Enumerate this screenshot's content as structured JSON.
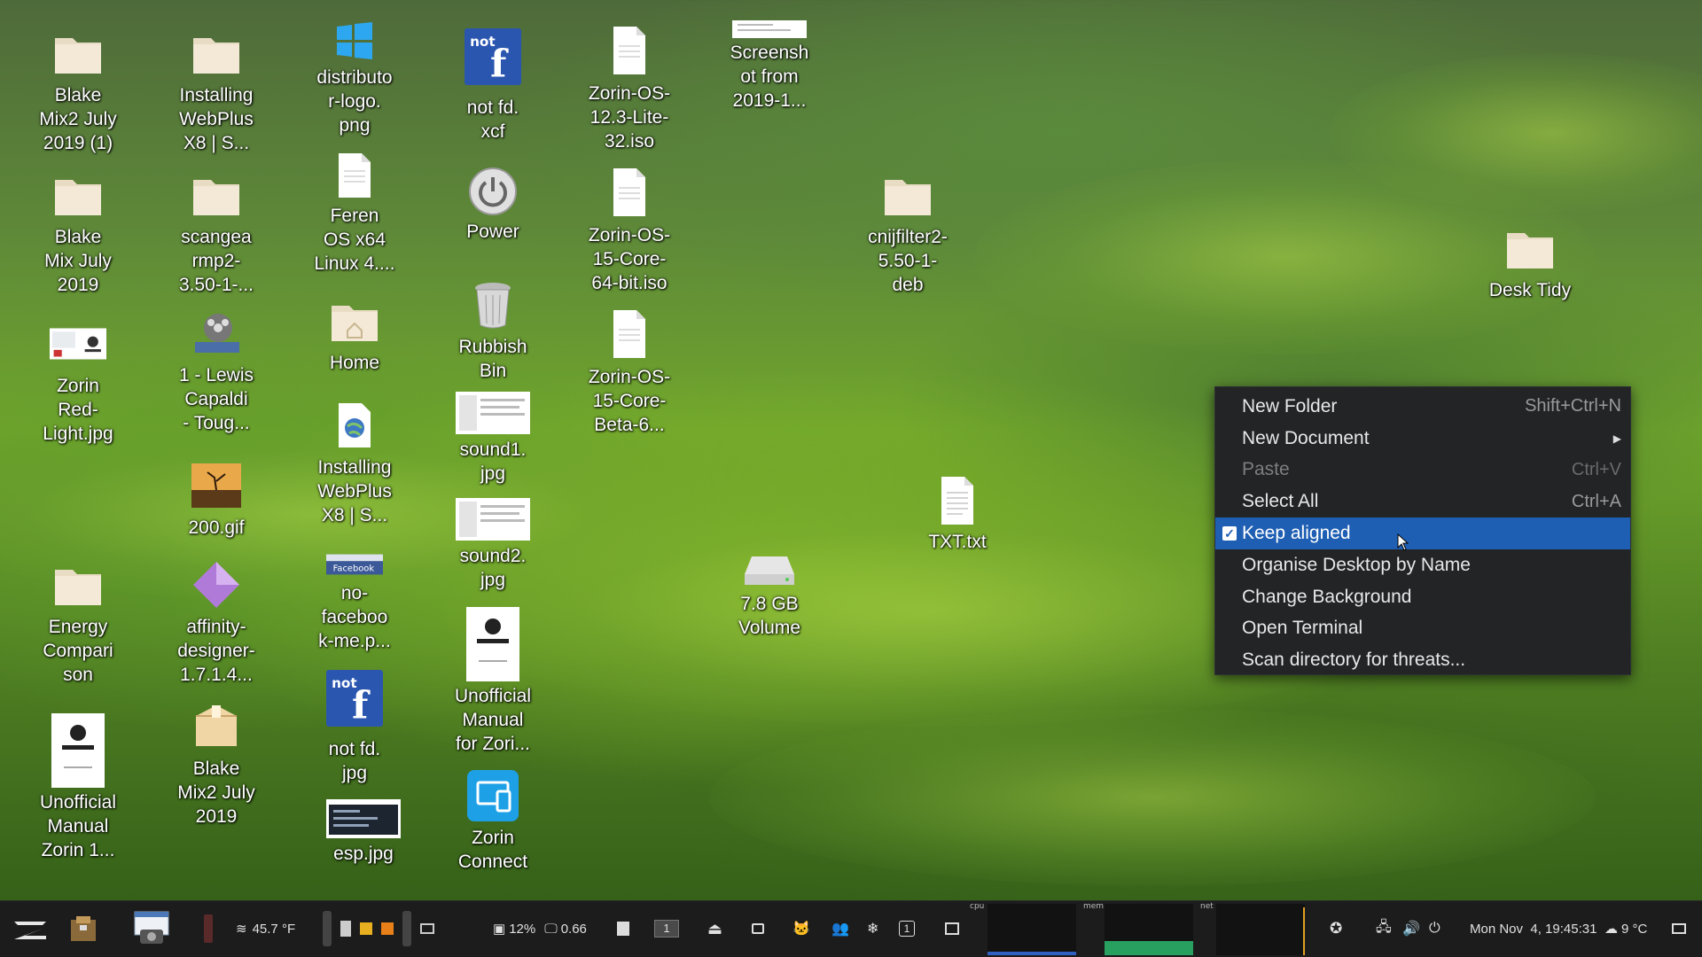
{
  "desktop_icons": [
    {
      "label": "Blake\nMix2 July\n2019 (1)",
      "icon": "folder-icon"
    },
    {
      "label": "Installing\nWebPlus\nX8 | S...",
      "icon": "folder-icon"
    },
    {
      "label": "distributo\nr-logo.\npng",
      "icon": "windows-logo-icon"
    },
    {
      "label": "not fd.\nxcf",
      "icon": "not-facebook-image-icon"
    },
    {
      "label": "Zorin-OS-\n12.3-Lite-\n32.iso",
      "icon": "file-icon"
    },
    {
      "label": "Screensh\not from\n2019-1...",
      "icon": "screenshot-thumbnail-icon"
    },
    {
      "label": "Blake\nMix July\n2019",
      "icon": "folder-icon"
    },
    {
      "label": "scangea\nrmp2-\n3.50-1-...",
      "icon": "folder-icon"
    },
    {
      "label": "Feren\nOS x64\nLinux 4....",
      "icon": "file-icon"
    },
    {
      "label": "Power",
      "icon": "power-icon"
    },
    {
      "label": "Zorin-OS-\n15-Core-\n64-bit.iso",
      "icon": "file-icon"
    },
    {
      "label": "cnijfilter2-\n5.50-1-\ndeb",
      "icon": "folder-icon"
    },
    {
      "label": "Desk Tidy",
      "icon": "folder-icon"
    },
    {
      "label": "Zorin\nRed-\nLight.jpg",
      "icon": "zorin-image-icon"
    },
    {
      "label": "1 - Lewis\nCapaldi\n- Toug...",
      "icon": "video-reel-icon"
    },
    {
      "label": "Home",
      "icon": "home-folder-icon"
    },
    {
      "label": "Rubbish\nBin",
      "icon": "trash-icon"
    },
    {
      "label": "Zorin-OS-\n15-Core-\nBeta-6...",
      "icon": "file-icon"
    },
    {
      "label": "200.gif",
      "icon": "gif-image-icon"
    },
    {
      "label": "Installing\nWebPlus\nX8 | S...",
      "icon": "web-globe-icon"
    },
    {
      "label": "sound1.\njpg",
      "icon": "sound-image-icon"
    },
    {
      "label": "TXT.txt",
      "icon": "text-file-icon"
    },
    {
      "label": "sound2.\njpg",
      "icon": "sound-image-icon"
    },
    {
      "label": "no-\nfaceboo\nk-me.p...",
      "icon": "facebook-image-icon"
    },
    {
      "label": "7.8 GB\nVolume",
      "icon": "drive-icon"
    },
    {
      "label": "Energy\nCompari\nson",
      "icon": "folder-icon"
    },
    {
      "label": "affinity-\ndesigner-\n1.7.1.4...",
      "icon": "affinity-icon"
    },
    {
      "label": "Unofficial\nManual\nfor Zori...",
      "icon": "zorin-document-icon"
    },
    {
      "label": "not fd.\njpg",
      "icon": "not-facebook-image-icon"
    },
    {
      "label": "Unofficial\nManual\nZorin 1...",
      "icon": "zorin-document-icon"
    },
    {
      "label": "Blake\nMix2 July\n2019",
      "icon": "package-icon"
    },
    {
      "label": "esp.jpg",
      "icon": "esp-image-icon"
    },
    {
      "label": "Zorin\nConnect",
      "icon": "zorin-connect-icon"
    }
  ],
  "context_menu": {
    "items": [
      {
        "label": "New Folder",
        "shortcut": "Shift+Ctrl+N",
        "state": "normal"
      },
      {
        "label": "New Document",
        "shortcut": "",
        "state": "submenu"
      },
      {
        "label": "Paste",
        "shortcut": "Ctrl+V",
        "state": "disabled"
      },
      {
        "label": "Select All",
        "shortcut": "Ctrl+A",
        "state": "normal"
      },
      {
        "label": "Keep aligned",
        "shortcut": "",
        "state": "checked-active"
      },
      {
        "label": "Organise Desktop by Name",
        "shortcut": "",
        "state": "normal"
      },
      {
        "label": "Change Background",
        "shortcut": "",
        "state": "normal"
      },
      {
        "label": "Open Terminal",
        "shortcut": "",
        "state": "normal"
      },
      {
        "label": "Scan directory for threats...",
        "shortcut": "",
        "state": "normal"
      }
    ]
  },
  "panel": {
    "weather_temp": "45.7 °F",
    "cpu_percent": "12%",
    "load_avg": "0.66",
    "workspace": "1",
    "workspace_counter": "1",
    "graph_cpu_label": "cpu",
    "graph_mem_label": "mem",
    "graph_net_label": "net",
    "clock": "Mon Nov  4, 19:45:31",
    "temp_c": "9 °C"
  },
  "colors": {
    "menu_bg": "#222426",
    "menu_active": "#1f5fb3",
    "panel_bg": "#1c1c1c"
  }
}
